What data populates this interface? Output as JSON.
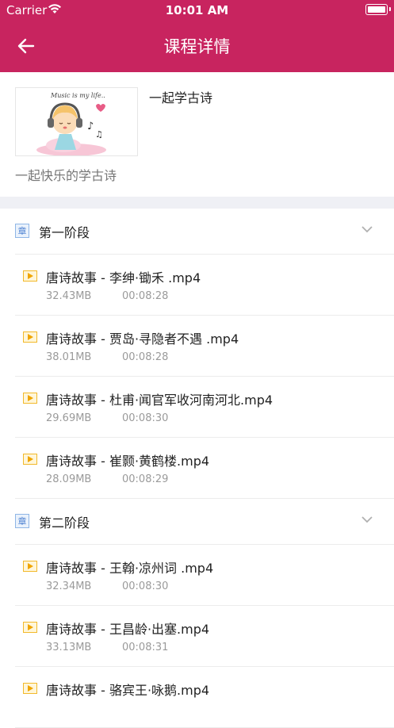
{
  "status_bar": {
    "carrier": "Carrier",
    "time": "10:01 AM"
  },
  "nav": {
    "title": "课程详情",
    "back_icon": "arrow-left-icon"
  },
  "course": {
    "title": "一起学古诗",
    "subtitle": "一起快乐的学古诗",
    "thumbnail_text": "Music is my life.."
  },
  "chapters": [
    {
      "badge": "章",
      "title": "第一阶段",
      "lessons": [
        {
          "title": "唐诗故事 - 李绅·锄禾 .mp4",
          "size": "32.43MB",
          "duration": "00:08:28"
        },
        {
          "title": "唐诗故事 - 贾岛·寻隐者不遇 .mp4",
          "size": "38.01MB",
          "duration": "00:08:28"
        },
        {
          "title": "唐诗故事 - 杜甫·闻官军收河南河北.mp4",
          "size": "29.69MB",
          "duration": "00:08:30"
        },
        {
          "title": "唐诗故事 - 崔颢·黄鹤楼.mp4",
          "size": "28.09MB",
          "duration": "00:08:29"
        }
      ]
    },
    {
      "badge": "章",
      "title": "第二阶段",
      "lessons": [
        {
          "title": "唐诗故事 - 王翰·凉州词 .mp4",
          "size": "32.34MB",
          "duration": "00:08:30"
        },
        {
          "title": "唐诗故事 - 王昌龄·出塞.mp4",
          "size": "33.13MB",
          "duration": "00:08:31"
        },
        {
          "title": "唐诗故事 - 骆宾王·咏鹅.mp4",
          "size": "",
          "duration": ""
        }
      ]
    }
  ],
  "colors": {
    "nav_bg": "#c8245f",
    "section_gap": "#eff0f5",
    "play_icon": "#f0a500",
    "chapter_badge": "#4a7fcf"
  }
}
